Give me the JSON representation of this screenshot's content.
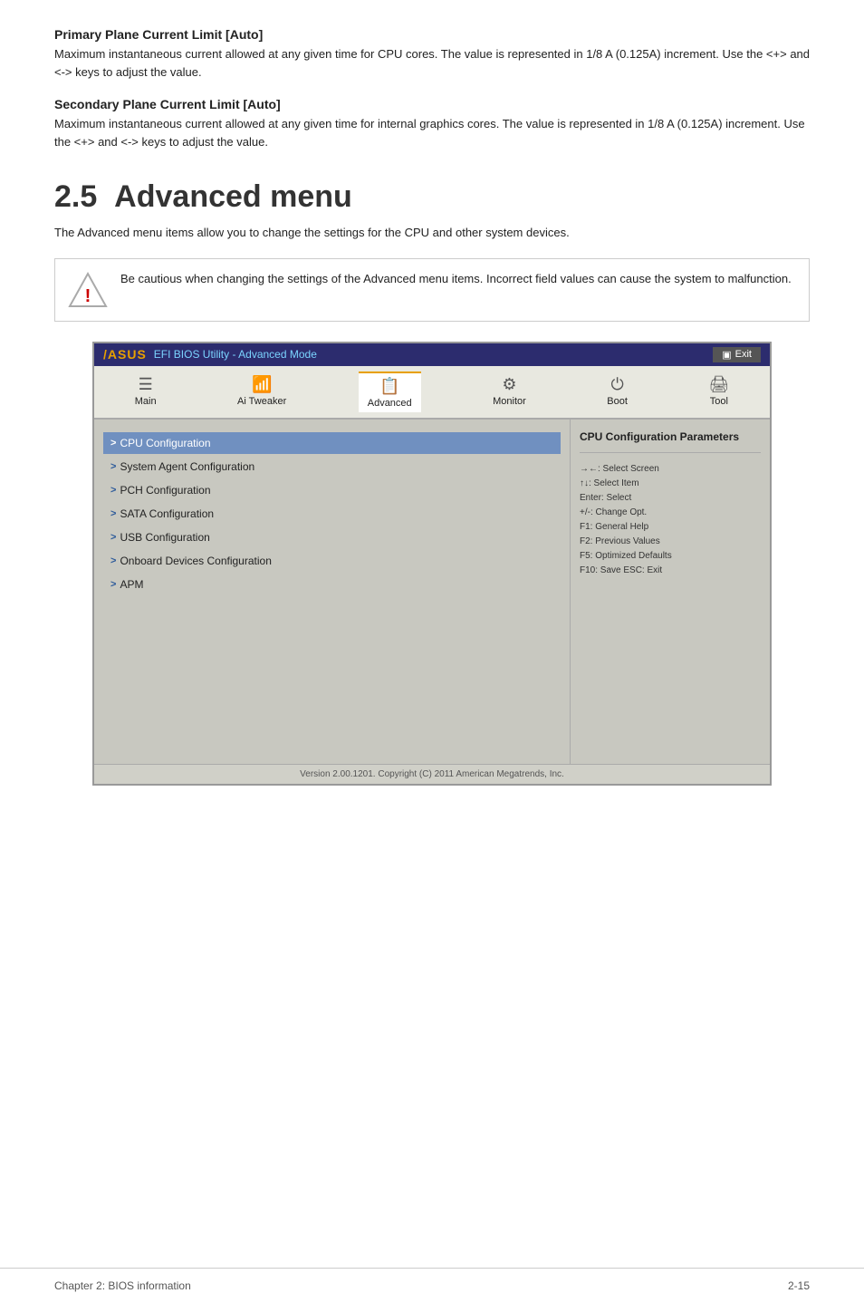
{
  "primaryLimit": {
    "heading": "Primary Plane Current Limit [Auto]",
    "description": "Maximum instantaneous current allowed at any given time for CPU cores. The value is represented in 1/8 A (0.125A) increment. Use the <+> and <-> keys to adjust the value."
  },
  "secondaryLimit": {
    "heading": "Secondary Plane Current Limit [Auto]",
    "description": "Maximum instantaneous current allowed at any given time for internal graphics cores. The value is represented in 1/8 A (0.125A) increment. Use the <+> and <-> keys to adjust the value."
  },
  "chapter": {
    "number": "2.5",
    "title": "Advanced menu",
    "intro": "The Advanced menu items allow you to change the settings for the CPU and other system devices."
  },
  "warning": {
    "text": "Be cautious when changing the settings of the Advanced menu items. Incorrect field values can cause the system to malfunction."
  },
  "bios": {
    "titlebar": {
      "logo": "/ASUS",
      "title": "EFI BIOS Utility - Advanced Mode",
      "exit_label": "Exit"
    },
    "nav": [
      {
        "id": "main",
        "label": "Main",
        "icon": "≡"
      },
      {
        "id": "ai-tweaker",
        "label": "Ai Tweaker",
        "icon": "📶"
      },
      {
        "id": "advanced",
        "label": "Advanced",
        "icon": "📋",
        "active": true
      },
      {
        "id": "monitor",
        "label": "Monitor",
        "icon": "⚙"
      },
      {
        "id": "boot",
        "label": "Boot",
        "icon": "⏻"
      },
      {
        "id": "tool",
        "label": "Tool",
        "icon": "🖨"
      }
    ],
    "menu_items": [
      {
        "label": "CPU Configuration",
        "selected": true
      },
      {
        "label": "System Agent Configuration",
        "selected": false
      },
      {
        "label": "PCH Configuration",
        "selected": false
      },
      {
        "label": "SATA Configuration",
        "selected": false
      },
      {
        "label": "USB Configuration",
        "selected": false
      },
      {
        "label": "Onboard Devices Configuration",
        "selected": false
      },
      {
        "label": "APM",
        "selected": false
      }
    ],
    "help": {
      "title": "CPU Configuration Parameters"
    },
    "keys": [
      "→←: Select Screen",
      "↑↓: Select Item",
      "Enter: Select",
      "+/-: Change Opt.",
      "F1:  General Help",
      "F2:  Previous Values",
      "F5:  Optimized Defaults",
      "F10: Save   ESC: Exit"
    ],
    "footer": "Version 2.00.1201.  Copyright (C) 2011 American Megatrends, Inc."
  },
  "page_footer": {
    "left": "Chapter 2: BIOS information",
    "right": "2-15"
  }
}
